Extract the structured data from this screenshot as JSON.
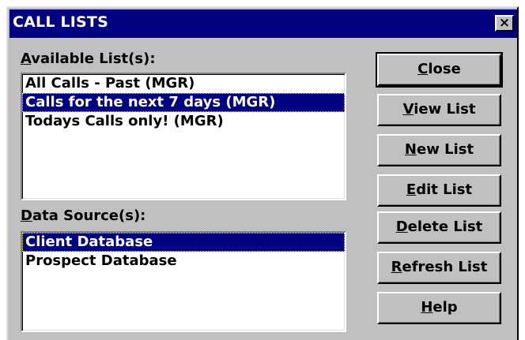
{
  "window": {
    "title": "CALL LISTS",
    "close_glyph": "×"
  },
  "available": {
    "label_mnemonic": "A",
    "label_rest": "vailable List(s):",
    "items": [
      {
        "label": "All Calls - Past (MGR)",
        "selected": false
      },
      {
        "label": "Calls for the next 7 days (MGR)",
        "selected": true
      },
      {
        "label": "Todays Calls only! (MGR)",
        "selected": false
      }
    ]
  },
  "datasource": {
    "label_mnemonic": "D",
    "label_rest": "ata Source(s):",
    "items": [
      {
        "label": "Client Database",
        "selected": true
      },
      {
        "label": "Prospect Database",
        "selected": false
      }
    ]
  },
  "buttons": {
    "close": {
      "mnemonic": "C",
      "rest": "lose"
    },
    "view": {
      "mnemonic": "V",
      "rest": "iew List"
    },
    "new": {
      "mnemonic": "N",
      "rest": "ew List"
    },
    "edit": {
      "mnemonic": "E",
      "rest": "dit List"
    },
    "delete": {
      "mnemonic": "D",
      "rest": "elete List"
    },
    "refresh": {
      "mnemonic": "R",
      "rest": "efresh List"
    },
    "help": {
      "mnemonic": "H",
      "rest": "elp"
    }
  },
  "colors": {
    "titlebar": "#000080",
    "selection": "#000080",
    "face": "#c0c0c0"
  }
}
